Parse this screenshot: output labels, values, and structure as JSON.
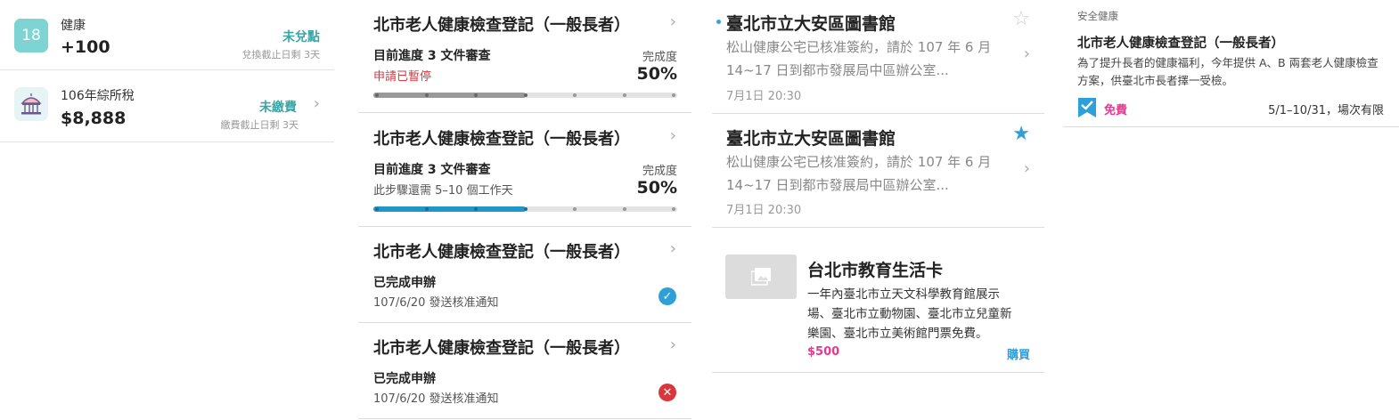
{
  "points_card": {
    "badge": "18",
    "label": "健康",
    "value": "+100",
    "status": "未兌點",
    "sub": "兌換截止日剩 3天",
    "status_color": "#3aa5a5"
  },
  "tax_card": {
    "label": "106年綜所稅",
    "value": "$8,888",
    "status": "未繳費",
    "sub": "繳費截止日剩 3天",
    "icon": "government-building-icon"
  },
  "applications": [
    {
      "title": "北市老人健康檢查登記（一般長者）",
      "progress": "目前進度 3 文件審查",
      "note": "申請已暫停",
      "note_color": "#d9363e",
      "completion_label": "完成度",
      "completion": "50%",
      "progress_fraction": 0.5,
      "bar_color": "#999999"
    },
    {
      "title": "北市老人健康檢查登記（一般長者）",
      "progress": "目前進度 3 文件審查",
      "note": "此步驟還需 5–10 個工作天",
      "note_color": "#555555",
      "completion_label": "完成度",
      "completion": "50%",
      "progress_fraction": 0.5,
      "bar_color": "#2196c9"
    },
    {
      "title": "北市老人健康檢查登記（一般長者）",
      "status": "已完成申辦",
      "note": "107/6/20 發送核准通知",
      "result_icon": "check-circle-icon",
      "result_color": "#2f9fd8"
    },
    {
      "title": "北市老人健康檢查登記（一般長者）",
      "status": "已完成申辦",
      "note": "107/6/20 發送核准通知",
      "result_icon": "x-circle-icon",
      "result_color": "#d9363e"
    }
  ],
  "messages": [
    {
      "title": "臺北市立大安區圖書館",
      "body": "松山健康公宅已核准簽約，請於 107 年 6 月 14~17 日到都市發展局中區辦公室...",
      "time": "7月1日 20:30",
      "unread": true,
      "starred": false
    },
    {
      "title": "臺北市立大安區圖書館",
      "body": "松山健康公宅已核准簽約，請於 107 年 6 月 14~17 日到都市發展局中區辦公室...",
      "time": "7月1日 20:30",
      "unread": false,
      "starred": true
    }
  ],
  "product": {
    "title": "台北市教育生活卡",
    "desc": "一年內臺北市立天文科學教育館展示場、臺北市立動物園、臺北市立兒童新樂園、臺北市立美術館門票免費。",
    "price": "$500",
    "buy": "購買",
    "price_color": "#e23b8f",
    "buy_color": "#2f9fd8"
  },
  "service": {
    "category": "安全健康",
    "title": "北市老人健康檢查登記（一般長者）",
    "desc": "為了提升長者的健康福利，今年提供 A、B 兩套老人健康檢查方案，供臺北市長者擇一受檢。",
    "fee": "免費",
    "period": "5/1–10/31，場次有限",
    "fee_color": "#e23b8f",
    "bookmark_color": "#2f9fd8"
  }
}
